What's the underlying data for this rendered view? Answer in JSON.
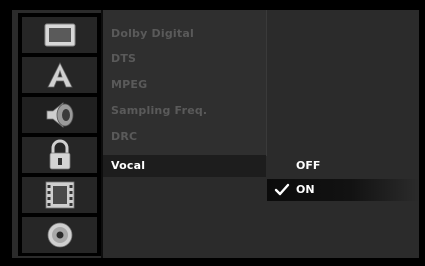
{
  "audio_menu": {
    "items": [
      "Dolby Digital",
      "DTS",
      "MPEG",
      "Sampling Freq.",
      "DRC"
    ],
    "selected_item": "Vocal"
  },
  "vocal_options": {
    "off_label": "OFF",
    "on_label": "ON",
    "checked": "ON"
  },
  "sidebar": {
    "icons": [
      "tv-screen-icon",
      "language-a-icon",
      "speaker-audio-icon",
      "padlock-icon",
      "film-frame-icon",
      "disc-icon"
    ],
    "selected": "speaker-audio-icon"
  },
  "colors": {
    "background": "#2b2b2b",
    "active_text": "#ffffff",
    "inactive_text": "#5a5a5a"
  }
}
